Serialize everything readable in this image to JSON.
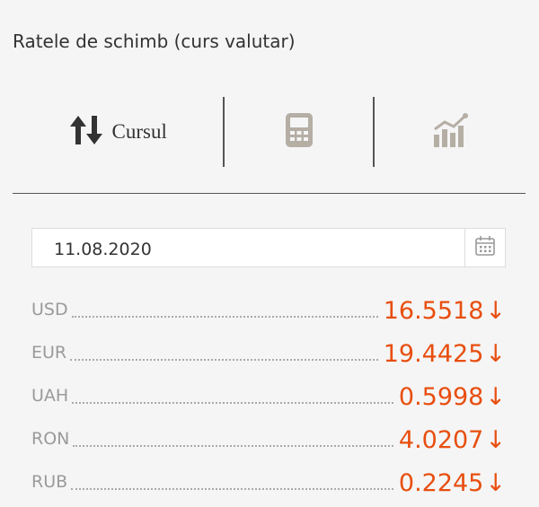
{
  "header": {
    "title": "Ratele de schimb (curs valutar)"
  },
  "tabs": {
    "rates_label": "Cursul",
    "icons": [
      "up-down-arrows-icon",
      "calculator-icon",
      "bar-chart-icon"
    ]
  },
  "date_field": {
    "value": "11.08.2020"
  },
  "colors": {
    "accent": "#e84e0f",
    "muted_icon": "#b5aea5",
    "dark_icon": "#333333"
  },
  "rates": [
    {
      "code": "USD",
      "value": "16.5518",
      "trend": "↓"
    },
    {
      "code": "EUR",
      "value": "19.4425",
      "trend": "↓"
    },
    {
      "code": "UAH",
      "value": "0.5998",
      "trend": "↓"
    },
    {
      "code": "RON",
      "value": "4.0207",
      "trend": "↓"
    },
    {
      "code": "RUB",
      "value": "0.2245",
      "trend": "↓"
    }
  ]
}
